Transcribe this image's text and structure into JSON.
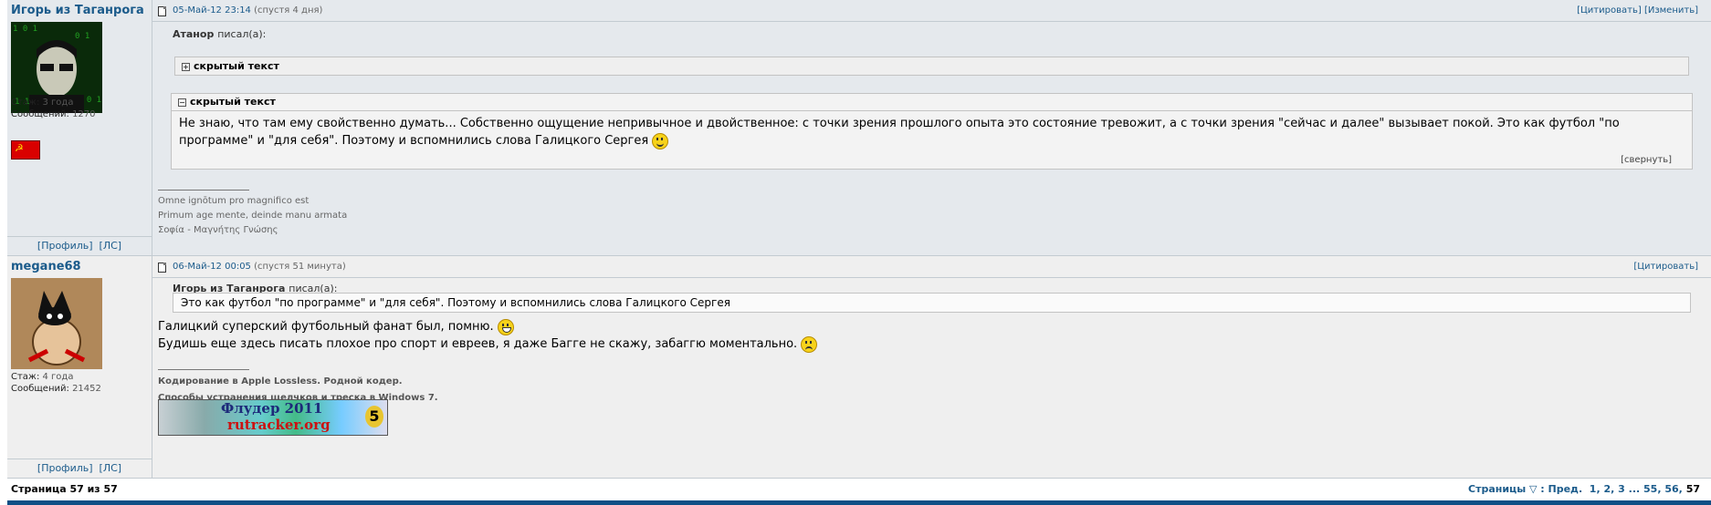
{
  "post1": {
    "author": "Игорь из Таганрога",
    "stats": {
      "exp_label": "Стаж:",
      "exp_value": "3 года",
      "msgs_label": "Сообщений:",
      "msgs_value": "1270"
    },
    "flag_icon": "ussr-flag",
    "date": "05-Май-12 23:14",
    "ago": "(спустя 4 дня)",
    "actions": {
      "quote": "[Цитировать]",
      "edit": "[Изменить]"
    },
    "quote_author": "Атанор",
    "quote_wrote": "писал(а):",
    "spoiler_closed_title": "скрытый текст",
    "spoiler_open_title": "скрытый текст",
    "spoiler_text": "Не знаю, что там ему свойственно думать... Собственно ощущение непривычное и двойственное: с точки зрения прошлого опыта это состояние тревожит, а с точки зрения \"сейчас и далее\" вызывает покой. Это как футбол \"по программе\" и \"для себя\". Поэтому и вспомнились слова Галицкого Сергея",
    "fold": "[свернуть]",
    "signature": [
      "Omne ignōtum pro magnifico est",
      "Primum age mente, deinde manu armata",
      "Σοφία - Μαγνήτης Γνώσης"
    ],
    "links": {
      "profile": "[Профиль]",
      "pm": "[ЛС]"
    }
  },
  "post2": {
    "author": "megane68",
    "stats": {
      "exp_label": "Стаж:",
      "exp_value": "4 года",
      "msgs_label": "Сообщений:",
      "msgs_value": "21452"
    },
    "date": "06-Май-12 00:05",
    "ago": "(спустя 51 минута)",
    "actions": {
      "quote": "[Цитировать]"
    },
    "quote_author": "Игорь из Таганрога",
    "quote_wrote": "писал(а):",
    "quote_text": "Это как футбол \"по программе\" и \"для себя\". Поэтому и вспомнились слова Галицкого Сергея",
    "line1": "Галицкий суперский футбольный фанат был, помню.",
    "line2": "Будишь еще здесь писать плохое про спорт и евреев, я даже Багге не скажу, забаггю моментально.",
    "signature": [
      "Кодирование в Apple Lossless. Родной кодер.",
      "Способы устранения щелчков и треска в Windows 7."
    ],
    "banner": {
      "line1": "Флудер 2011",
      "line2": "rutracker.org",
      "medal": "5"
    },
    "links": {
      "profile": "[Профиль]",
      "pm": "[ЛС]"
    }
  },
  "footer": {
    "page_info": "Страница 57 из 57",
    "pages_label": "Страницы",
    "prev": "Пред.",
    "pages": [
      "1",
      "2",
      "3",
      "...",
      "55",
      "56"
    ],
    "current": "57"
  }
}
